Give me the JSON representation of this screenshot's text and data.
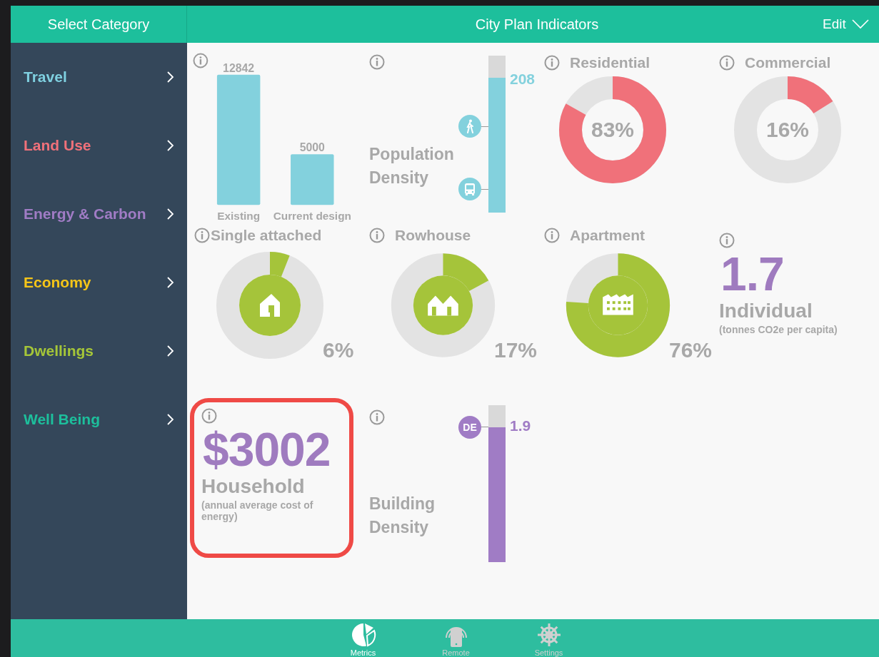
{
  "header": {
    "left": "Select Category",
    "title": "City Plan Indicators",
    "edit": "Edit"
  },
  "sidebar": {
    "items": [
      {
        "label": "Travel",
        "color": "#7fd0e0"
      },
      {
        "label": "Land Use",
        "color": "#f0717a"
      },
      {
        "label": "Energy & Carbon",
        "color": "#a07cc5"
      },
      {
        "label": "Economy",
        "color": "#f5c518"
      },
      {
        "label": "Dwellings",
        "color": "#a5c638"
      },
      {
        "label": "Well Being",
        "color": "#1dbf9c"
      }
    ]
  },
  "cards": [
    {
      "kind": "bars",
      "chart_data": {
        "type": "bar",
        "categories": [
          "Existing",
          "Current design"
        ],
        "values": [
          12842,
          5000
        ],
        "data_labels": true
      }
    },
    {
      "kind": "column",
      "title": "Population Density",
      "value": "208",
      "level": 0.86,
      "color": "#83d1dd",
      "markers": [
        {
          "kind": "walk"
        },
        {
          "kind": "bus"
        }
      ]
    },
    {
      "kind": "donut",
      "title": "Residential",
      "value": "83%",
      "level": 0.83,
      "color": "#f0717a"
    },
    {
      "kind": "donut",
      "title": "Commercial",
      "value": "16%",
      "level": 0.16,
      "color": "#f0717a"
    },
    {
      "kind": "dwelling",
      "title": "Single attached",
      "value": "6%",
      "level": 0.06
    },
    {
      "kind": "dwelling",
      "title": "Rowhouse",
      "value": "17%",
      "level": 0.17
    },
    {
      "kind": "dwelling",
      "title": "Apartment",
      "value": "76%",
      "level": 0.76
    },
    {
      "kind": "figure",
      "value": "1.7",
      "label": "Individual",
      "note": "(tonnes CO2e per capita)",
      "highlighted": false
    },
    {
      "kind": "figure",
      "value": "$3002",
      "label": "Household",
      "note": "(annual average cost of energy)",
      "highlighted": true
    },
    {
      "kind": "column",
      "title": "Building Density",
      "value": "1.9",
      "level": 0.86,
      "color": "#a07cc5",
      "markers": [
        {
          "kind": "badge",
          "text": "DE"
        }
      ]
    }
  ],
  "tab_bar": [
    {
      "label": "Metrics",
      "selected": true
    },
    {
      "label": "Remote",
      "selected": false
    },
    {
      "label": "Settings",
      "selected": false
    }
  ]
}
